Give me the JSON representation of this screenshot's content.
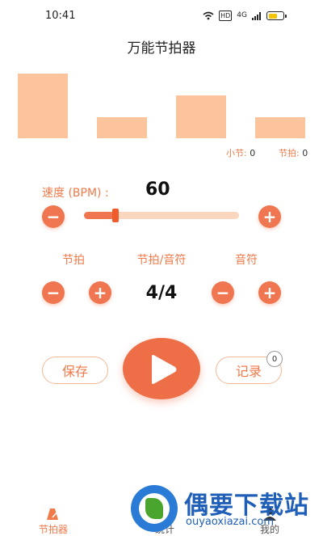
{
  "status_bar": {
    "time": "10:41",
    "wifi_icon": "wifi-icon",
    "hd_badge": "HD",
    "signal_text": "4G"
  },
  "app_title": "万能节拍器",
  "beat_bars": [
    {
      "level": 1.0,
      "active": true
    },
    {
      "level": 0.32,
      "active": false
    },
    {
      "level": 0.66,
      "active": false
    },
    {
      "level": 0.32,
      "active": false
    }
  ],
  "counters": {
    "measure_label": "小节:",
    "measure_value": "0",
    "beat_label": "节拍:",
    "beat_value": "0"
  },
  "tempo": {
    "label": "速度 (BPM) :",
    "value": "60",
    "minus": "−",
    "plus": "+",
    "slider_fraction": 0.2
  },
  "signature": {
    "beat_label": "节拍",
    "beat_note_label": "节拍/音符",
    "note_label": "音符",
    "value": "4/4",
    "minus": "−",
    "plus": "+"
  },
  "actions": {
    "save": "保存",
    "record": "记录",
    "record_count": "0"
  },
  "tabs": [
    {
      "label": "节拍器",
      "icon": "metronome-icon",
      "active": true
    },
    {
      "label": "统计",
      "icon": "chart-icon",
      "active": false
    },
    {
      "label": "我的",
      "icon": "user-icon",
      "active": false
    }
  ],
  "watermark": {
    "title": "偶要下载站",
    "url": "ouyaoxiazai.com"
  },
  "colors": {
    "accent": "#ef7650",
    "beat_bar": "#fcc49c",
    "track": "#fbd6bf",
    "label": "#f07a4a"
  }
}
